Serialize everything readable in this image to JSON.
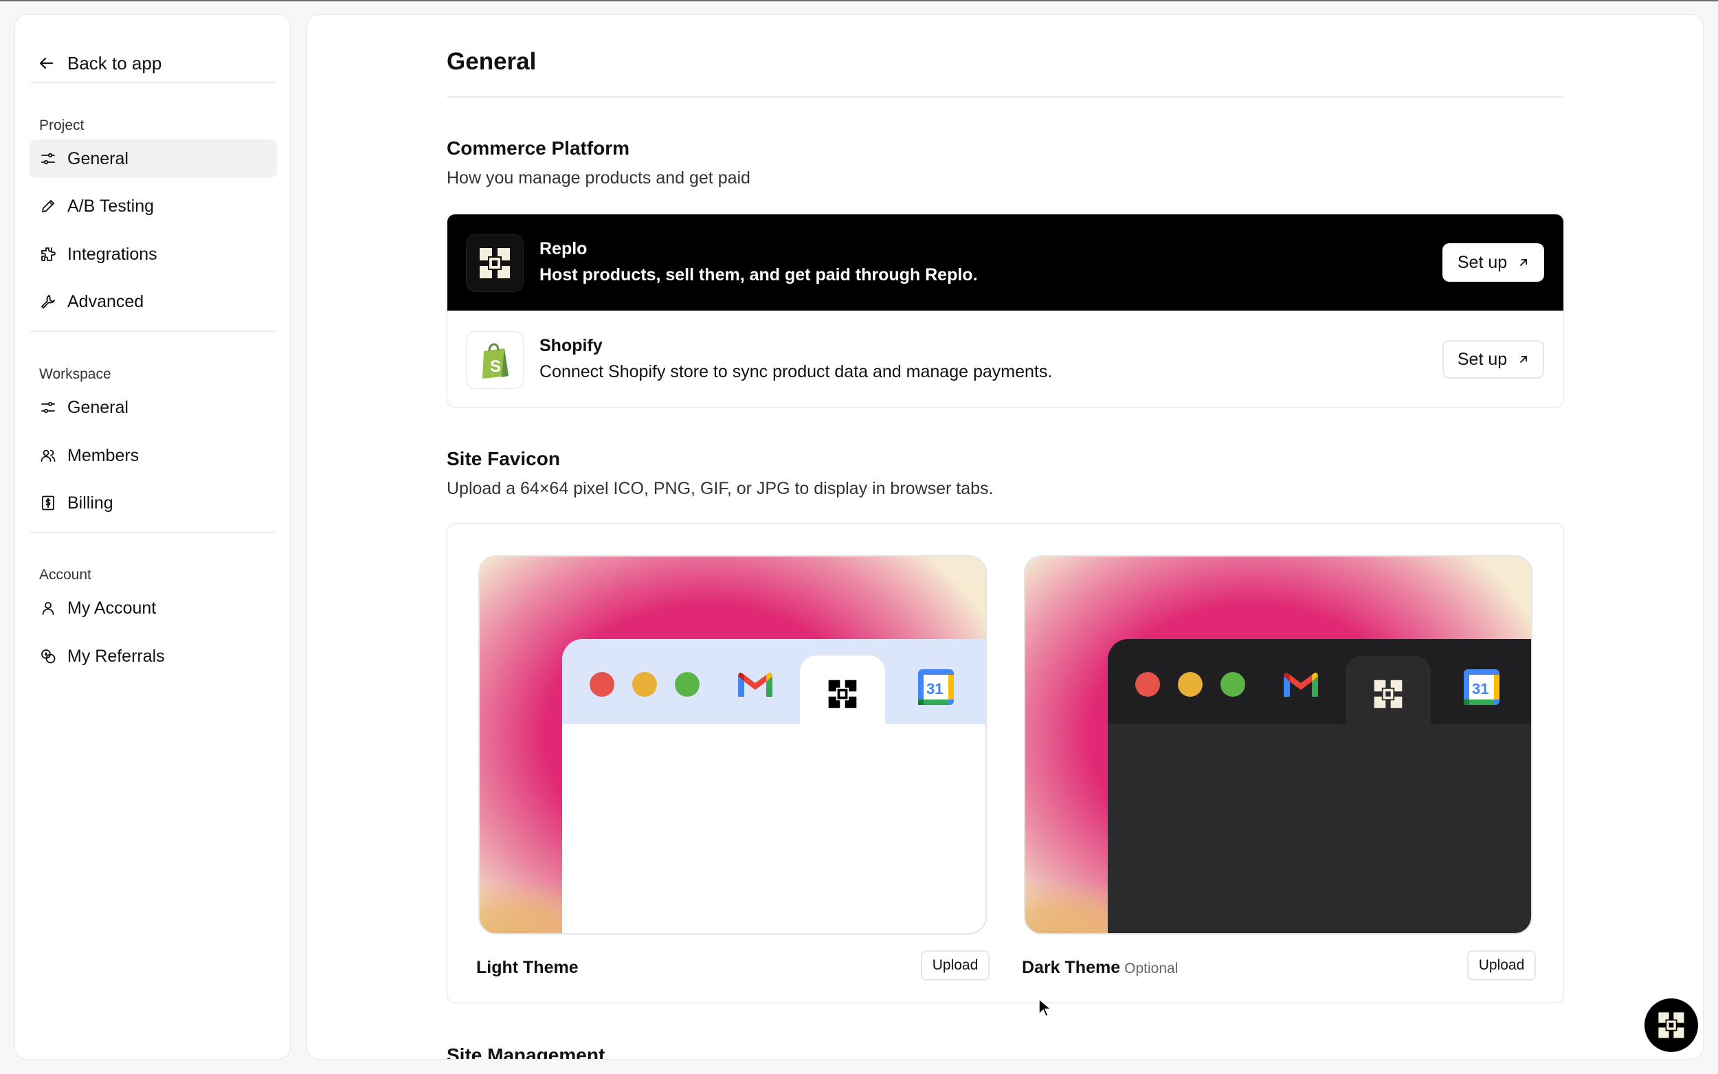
{
  "sidebar": {
    "back_label": "Back to app",
    "sections": [
      {
        "label": "Project",
        "items": [
          {
            "label": "General",
            "icon": "sliders-icon",
            "active": true
          },
          {
            "label": "A/B Testing",
            "icon": "pencil-icon"
          },
          {
            "label": "Integrations",
            "icon": "puzzle-icon"
          },
          {
            "label": "Advanced",
            "icon": "wrench-icon"
          }
        ]
      },
      {
        "label": "Workspace",
        "items": [
          {
            "label": "General",
            "icon": "sliders-icon"
          },
          {
            "label": "Members",
            "icon": "users-icon"
          },
          {
            "label": "Billing",
            "icon": "dollar-receipt-icon"
          }
        ]
      },
      {
        "label": "Account",
        "items": [
          {
            "label": "My Account",
            "icon": "user-icon"
          },
          {
            "label": "My Referrals",
            "icon": "coins-icon"
          }
        ]
      }
    ]
  },
  "main": {
    "title": "General",
    "commerce": {
      "heading": "Commerce Platform",
      "description": "How you manage products and get paid",
      "platforms": [
        {
          "name": "Replo",
          "description": "Host products, sell them, and get paid through Replo.",
          "button": "Set up"
        },
        {
          "name": "Shopify",
          "description": "Connect Shopify store to sync product data and manage payments.",
          "button": "Set up"
        }
      ]
    },
    "favicon": {
      "heading": "Site Favicon",
      "description": "Upload a 64×64 pixel ICO, PNG, GIF, or JPG to display in browser tabs.",
      "themes": [
        {
          "label": "Light Theme",
          "optional": "",
          "button": "Upload"
        },
        {
          "label": "Dark Theme",
          "optional": "Optional",
          "button": "Upload"
        }
      ]
    },
    "site_management": {
      "heading": "Site Management"
    }
  },
  "colors": {
    "accent": "#000000",
    "preview_pink": "#e02874",
    "shopify_green": "#5e8e3e"
  }
}
